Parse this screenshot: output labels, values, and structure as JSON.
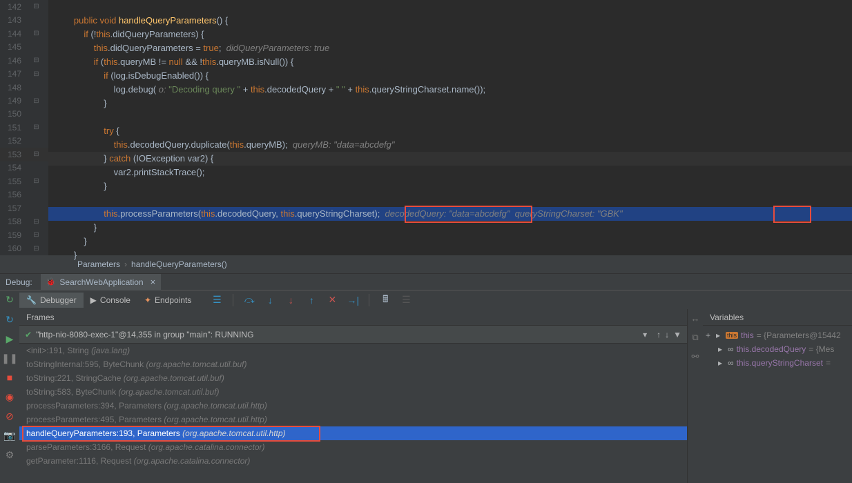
{
  "editor": {
    "lines": [
      {
        "n": 142,
        "fold": "-",
        "code": ""
      },
      {
        "n": 143,
        "code": "        public void handleQueryParameters() {"
      },
      {
        "n": 144,
        "fold": "-",
        "code": "            if (!this.didQueryParameters) {"
      },
      {
        "n": 145,
        "code": "                this.didQueryParameters = true;  didQueryParameters: true"
      },
      {
        "n": 146,
        "fold": "-",
        "code": "                if (this.queryMB != null && !this.queryMB.isNull()) {"
      },
      {
        "n": 147,
        "fold": "-",
        "code": "                    if (log.isDebugEnabled()) {"
      },
      {
        "n": 148,
        "code": "                        log.debug( o: \"Decoding query \" + this.decodedQuery + \" \" + this.queryStringCharset.name());"
      },
      {
        "n": 149,
        "fold": "-",
        "code": "                    }"
      },
      {
        "n": 150,
        "code": ""
      },
      {
        "n": 151,
        "fold": "-",
        "code": "                    try {"
      },
      {
        "n": 152,
        "code": "                        this.decodedQuery.duplicate(this.queryMB);  queryMB: \"data=abcdefg\""
      },
      {
        "n": 153,
        "fold": "-",
        "hl": true,
        "code": "                    } catch (IOException var2) {"
      },
      {
        "n": 154,
        "code": "                        var2.printStackTrace();"
      },
      {
        "n": 155,
        "fold": "-",
        "code": "                    }"
      },
      {
        "n": 156,
        "code": ""
      },
      {
        "n": 157,
        "hl157": true,
        "code": "                    this.processParameters(this.decodedQuery, this.queryStringCharset);  decodedQuery: \"data=abcdefg\"  queryStringCharset: \"GBK\""
      },
      {
        "n": 158,
        "fold": "-",
        "code": "                }"
      },
      {
        "n": 159,
        "fold": "-",
        "code": "            }"
      },
      {
        "n": 160,
        "fold": "-",
        "code": "        }"
      }
    ]
  },
  "breadcrumb": {
    "a": "Parameters",
    "b": "handleQueryParameters()"
  },
  "debug": {
    "label": "Debug:",
    "appname": "SearchWebApplication",
    "tabs": {
      "debugger": "Debugger",
      "console": "Console",
      "endpoints": "Endpoints"
    }
  },
  "frames": {
    "title": "Frames",
    "thread": "\"http-nio-8080-exec-1\"@14,355 in group \"main\": RUNNING",
    "items": [
      {
        "txt": "<init>:191, String",
        "pkg": "(java.lang)"
      },
      {
        "txt": "toStringInternal:595, ByteChunk",
        "pkg": "(org.apache.tomcat.util.buf)"
      },
      {
        "txt": "toString:221, StringCache",
        "pkg": "(org.apache.tomcat.util.buf)"
      },
      {
        "txt": "toString:583, ByteChunk",
        "pkg": "(org.apache.tomcat.util.buf)"
      },
      {
        "txt": "processParameters:394, Parameters",
        "pkg": "(org.apache.tomcat.util.http)"
      },
      {
        "txt": "processParameters:495, Parameters",
        "pkg": "(org.apache.tomcat.util.http)"
      },
      {
        "txt": "handleQueryParameters:193, Parameters",
        "pkg": "(org.apache.tomcat.util.http)",
        "sel": true
      },
      {
        "txt": "parseParameters:3166, Request",
        "pkg": "(org.apache.catalina.connector)"
      },
      {
        "txt": "getParameter:1116, Request",
        "pkg": "(org.apache.catalina.connector)"
      }
    ]
  },
  "variables": {
    "title": "Variables",
    "items": [
      {
        "name": "this",
        "val": " = {Parameters@15442",
        "ic": "this"
      },
      {
        "name": "this.decodedQuery",
        "val": " = {Mes",
        "ic": "oo"
      },
      {
        "name": "this.queryStringCharset",
        "val": " = ",
        "ic": "oo"
      }
    ]
  }
}
